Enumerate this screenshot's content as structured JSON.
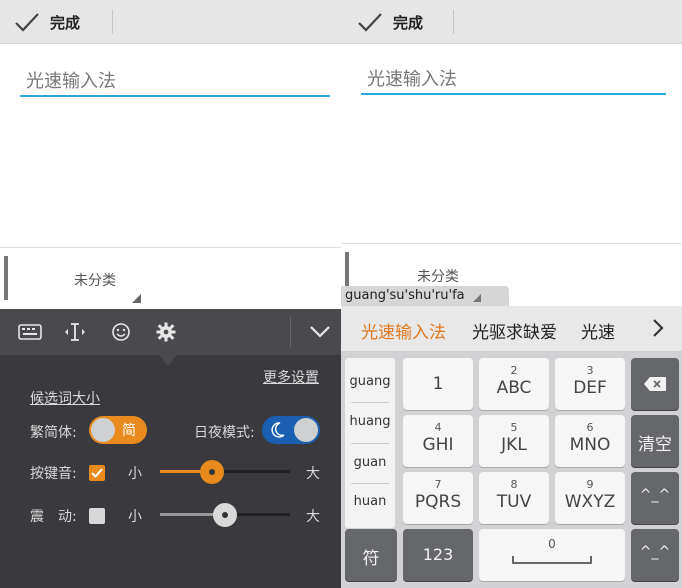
{
  "left": {
    "topbar": {
      "done_label": "完成"
    },
    "editor": {
      "title_placeholder": "光速输入法"
    },
    "category": {
      "label": "未分类"
    },
    "settings": {
      "more_settings": "更多设置",
      "candidate_size": "候选词大小",
      "trad_simp_label": "繁简体:",
      "trad_simp_value": "简",
      "night_mode_label": "日夜模式:",
      "night_mode_icon": "moon-icon",
      "key_sound_label": "按键音:",
      "key_sound_checked": true,
      "key_sound_level": 0.4,
      "vibration_label": "震　动:",
      "vibration_checked": false,
      "vibration_level": 0.5,
      "small_label": "小",
      "large_label": "大"
    },
    "colors": {
      "accent": "#e88a1e",
      "toggle_blue": "#1b5fb3",
      "panel": "#3a3a3e",
      "toolbar": "#4a4a4e"
    }
  },
  "right": {
    "topbar": {
      "done_label": "完成"
    },
    "editor": {
      "title_placeholder": "光速输入法"
    },
    "category": {
      "label": "未分类"
    },
    "pinyin_preview": "guang'su'shu'ru'fa",
    "candidates": [
      "光速输入法",
      "光驱求缺爱",
      "光速"
    ],
    "pinyin_options": [
      "guang",
      "huang",
      "guan",
      "huan"
    ],
    "keys": [
      {
        "num": "",
        "letters": "1"
      },
      {
        "num": "2",
        "letters": "ABC"
      },
      {
        "num": "3",
        "letters": "DEF"
      },
      {
        "num": "4",
        "letters": "GHI"
      },
      {
        "num": "5",
        "letters": "JKL"
      },
      {
        "num": "6",
        "letters": "MNO"
      },
      {
        "num": "7",
        "letters": "PQRS"
      },
      {
        "num": "8",
        "letters": "TUV"
      },
      {
        "num": "9",
        "letters": "WXYZ"
      }
    ],
    "side_keys": {
      "clear": "清空",
      "emoticon": "^_^",
      "emoticon2": "^_^"
    },
    "bottom_keys": {
      "symbol": "符",
      "num_mode": "123",
      "space_num": "0"
    },
    "colors": {
      "candidate_highlight": "#e07a22"
    }
  }
}
